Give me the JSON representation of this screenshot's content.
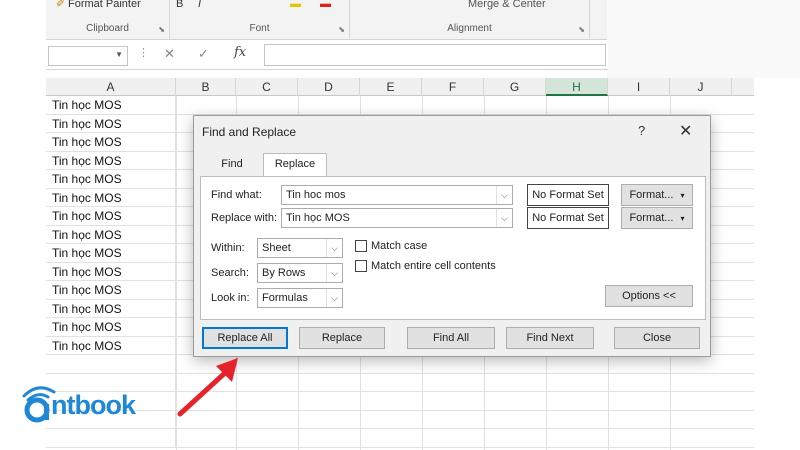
{
  "ribbon": {
    "format_painter_label": "Format Painter",
    "groups": {
      "clipboard": "Clipboard",
      "font": "Font",
      "alignment": "Alignment"
    },
    "merge_center_label": "Merge & Center"
  },
  "formula_bar": {
    "cancel_glyph": "✕",
    "enter_glyph": "✓",
    "fx_label": "fx"
  },
  "grid": {
    "columns": [
      "A",
      "B",
      "C",
      "D",
      "E",
      "F",
      "G",
      "H",
      "I",
      "J"
    ],
    "selected_column": "H",
    "cell_values": [
      "Tin học MOS",
      "Tin học MOS",
      "Tin học MOS",
      "Tin học MOS",
      "Tin học MOS",
      "Tin học MOS",
      "Tin học MOS",
      "Tin học MOS",
      "Tin học MOS",
      "Tin học MOS",
      "Tin học MOS",
      "Tin học MOS",
      "Tin học MOS",
      "Tin học MOS"
    ]
  },
  "dialog": {
    "title": "Find and Replace",
    "help_label": "?",
    "close_label": "✕",
    "tabs": {
      "find": "Find",
      "replace": "Replace"
    },
    "find_what_label": "Find what:",
    "find_what_value": "Tin hoc mos",
    "replace_with_label": "Replace with:",
    "replace_with_value": "Tin học MOS",
    "no_format_set": "No Format Set",
    "format_button": "Format...",
    "within_label": "Within:",
    "within_value": "Sheet",
    "search_label": "Search:",
    "search_value": "By Rows",
    "look_in_label": "Look in:",
    "look_in_value": "Formulas",
    "match_case_label": "Match case",
    "match_entire_label": "Match entire cell contents",
    "options_button": "Options <<",
    "buttons": {
      "replace_all": "Replace All",
      "replace": "Replace",
      "find_all": "Find All",
      "find_next": "Find Next",
      "close": "Close"
    }
  },
  "logo": {
    "text": "ntbook",
    "color": "#1e88d6"
  },
  "annotation": {
    "arrow_color": "#e5232a"
  }
}
